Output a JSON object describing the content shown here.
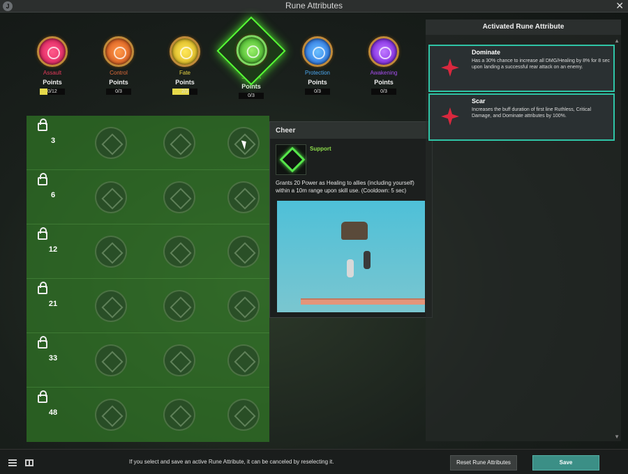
{
  "window": {
    "title": "Rune Attributes",
    "app_icon_letter": "J",
    "close_glyph": "✕"
  },
  "categories": [
    {
      "name": "Assault",
      "color": "#e43a5a",
      "orb_color": "#e6306a",
      "points_label": "Points",
      "value": "0/12",
      "fill": 0.3
    },
    {
      "name": "Control",
      "color": "#e06b3a",
      "orb_color": "#e36b2a",
      "points_label": "Points",
      "value": "0/3",
      "fill": 0
    },
    {
      "name": "Fate",
      "color": "#e9d443",
      "orb_color": "#e3c22e",
      "points_label": "Points",
      "value": "2/3",
      "fill": 0.67
    },
    {
      "name": "Support",
      "color": "#88df47",
      "orb_color": "#5ac33a",
      "points_label": "Points",
      "value": "0/3",
      "fill": 0,
      "active": true
    },
    {
      "name": "Protection",
      "color": "#4ca8f0",
      "orb_color": "#3b86e8",
      "points_label": "Points",
      "value": "0/3",
      "fill": 0
    },
    {
      "name": "Awakening",
      "color": "#a84ef0",
      "orb_color": "#8d3ae8",
      "points_label": "Points",
      "value": "0/3",
      "fill": 0
    }
  ],
  "grid": {
    "levels": [
      "3",
      "6",
      "12",
      "21",
      "33",
      "48"
    ]
  },
  "tooltip": {
    "title": "Cheer",
    "category": "Support",
    "description": "Grants 20 Power as Healing to allies (including yourself) within a 10m range upon skill use. (Cooldown: 5 sec)"
  },
  "panel": {
    "title": "Activated Rune Attribute",
    "attributes": [
      {
        "name": "Dominate",
        "description": "Has a 30% chance to increase all DMG/Healing by 8% for 8 sec upon landing a successful rear attack on an enemy.",
        "icon": "dominate-icon"
      },
      {
        "name": "Scar",
        "description": "Increases the buff duration of first line Ruthless, Critical Damage, and Dominate attributes by 100%.",
        "icon": "scar-icon"
      }
    ]
  },
  "footer": {
    "note": "If you select and save an active Rune Attribute, it can be canceled by reselecting it.",
    "reset_label": "Reset Rune Attributes",
    "save_label": "Save"
  }
}
